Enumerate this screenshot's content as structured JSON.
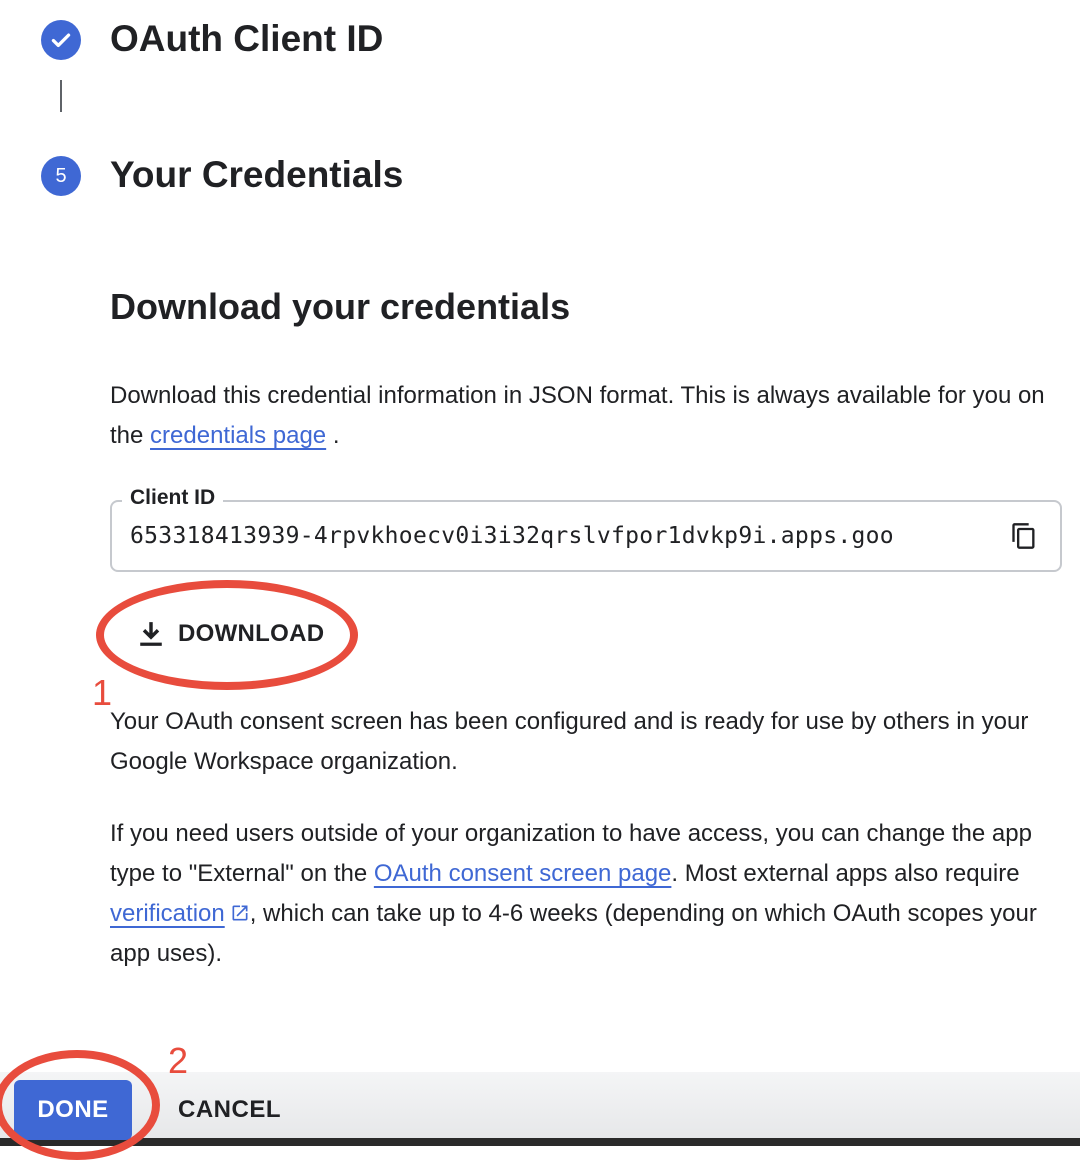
{
  "stepper": {
    "step4": {
      "title": "OAuth Client ID",
      "state": "completed",
      "icon": "check-icon"
    },
    "step5": {
      "number": "5",
      "title": "Your Credentials"
    }
  },
  "download_section": {
    "title": "Download your credentials",
    "intro_before_link": "Download this credential information in JSON format. This is always available for you on the ",
    "intro_link": "credentials page",
    "intro_after_link": " .",
    "client_id_label": "Client ID",
    "client_id_value": "653318413939-4rpvkhoecv0i3i32qrslvfpor1dvkp9i.apps.goo",
    "copy_icon": "copy-icon",
    "download_label": "DOWNLOAD",
    "download_icon": "download-icon"
  },
  "info": {
    "consent_configured": "Your OAuth consent screen has been configured and is ready for use by others in your Google Workspace organization.",
    "external_part1": "If you need users outside of your organization to have access, you can change the app type to \"External\" on the ",
    "consent_link": "OAuth consent screen page",
    "external_part2": ". Most external apps also require ",
    "verification_link": "verification",
    "external_part3": ", which can take up to 4-6 weeks (depending on which OAuth scopes your app uses)."
  },
  "footer": {
    "done_label": "DONE",
    "cancel_label": "CANCEL"
  },
  "annotations": {
    "marker1": "1",
    "marker2": "2",
    "color": "#e84c3d"
  },
  "colors": {
    "accent": "#3f68d4",
    "text": "#202124"
  }
}
